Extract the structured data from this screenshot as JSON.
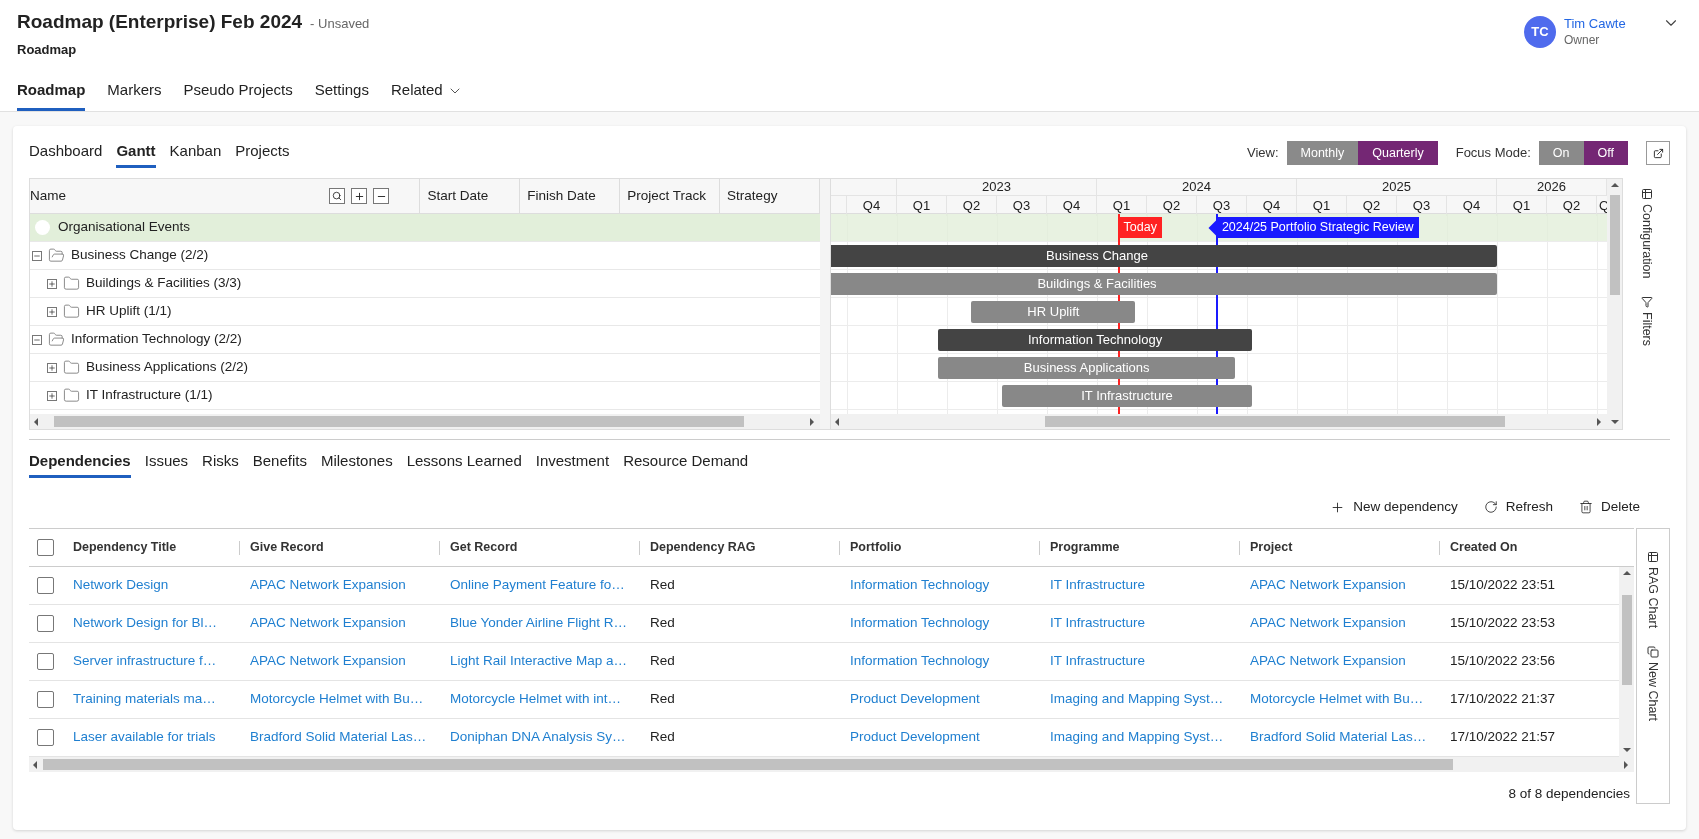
{
  "header": {
    "title": "Roadmap (Enterprise) Feb 2024",
    "status": "- Unsaved",
    "subtitle": "Roadmap"
  },
  "user": {
    "initials": "TC",
    "name": "Tim Cawte",
    "role": "Owner"
  },
  "nav_tabs": [
    {
      "label": "Roadmap",
      "selected": true,
      "dropdown": false
    },
    {
      "label": "Markers",
      "selected": false,
      "dropdown": false
    },
    {
      "label": "Pseudo Projects",
      "selected": false,
      "dropdown": false
    },
    {
      "label": "Settings",
      "selected": false,
      "dropdown": false
    },
    {
      "label": "Related",
      "selected": false,
      "dropdown": true
    }
  ],
  "view_tabs": [
    {
      "label": "Dashboard",
      "selected": false
    },
    {
      "label": "Gantt",
      "selected": true
    },
    {
      "label": "Kanban",
      "selected": false
    },
    {
      "label": "Projects",
      "selected": false
    }
  ],
  "view_switch": {
    "label": "View:",
    "options": [
      {
        "label": "Monthly",
        "selected": false
      },
      {
        "label": "Quarterly",
        "selected": true
      }
    ]
  },
  "focus_mode": {
    "label": "Focus Mode:",
    "options": [
      {
        "label": "On",
        "selected": false
      },
      {
        "label": "Off",
        "selected": true
      }
    ]
  },
  "gantt": {
    "columns": [
      "Name",
      "Start Date",
      "Finish Date",
      "Project Track",
      "Strategy"
    ],
    "years": [
      "2023",
      "2024",
      "2025",
      "2026"
    ],
    "quarters": [
      "Q4",
      "Q1",
      "Q2",
      "Q3",
      "Q4",
      "Q1",
      "Q2",
      "Q3",
      "Q4",
      "Q1",
      "Q2",
      "Q3",
      "Q4",
      "Q1",
      "Q2",
      "Q"
    ],
    "markers": [
      {
        "label": "Today",
        "kind": "today",
        "color": "#ff2222"
      },
      {
        "label": "2024/25 Portfolio Strategic Review",
        "kind": "milestone",
        "color": "#1a1aff"
      }
    ],
    "rows": [
      {
        "name": "Organisational Events",
        "kind": "events"
      },
      {
        "name": "Business Change (2/2)",
        "kind": "group",
        "expanded": true,
        "bar": {
          "label": "Business Change"
        },
        "children": [
          {
            "name": "Buildings & Facilities (3/3)",
            "kind": "group",
            "expanded": false,
            "bar": {
              "label": "Buildings & Facilities"
            }
          },
          {
            "name": "HR Uplift (1/1)",
            "kind": "group",
            "expanded": false,
            "bar": {
              "label": "HR Uplift"
            }
          }
        ]
      },
      {
        "name": "Information Technology (2/2)",
        "kind": "group",
        "expanded": true,
        "bar": {
          "label": "Information Technology"
        },
        "children": [
          {
            "name": "Business Applications (2/2)",
            "kind": "group",
            "expanded": false,
            "bar": {
              "label": "Business Applications"
            }
          },
          {
            "name": "IT Infrastructure (1/1)",
            "kind": "group",
            "expanded": false,
            "bar": {
              "label": "IT Infrastructure"
            }
          }
        ]
      }
    ]
  },
  "side_panel": [
    "Configuration",
    "Filters"
  ],
  "detail_tabs": [
    {
      "label": "Dependencies",
      "selected": true
    },
    {
      "label": "Issues",
      "selected": false
    },
    {
      "label": "Risks",
      "selected": false
    },
    {
      "label": "Benefits",
      "selected": false
    },
    {
      "label": "Milestones",
      "selected": false
    },
    {
      "label": "Lessons Learned",
      "selected": false
    },
    {
      "label": "Investment",
      "selected": false
    },
    {
      "label": "Resource Demand",
      "selected": false
    }
  ],
  "actions": [
    "New dependency",
    "Refresh",
    "Delete"
  ],
  "table": {
    "select_all": {
      "checked": false
    },
    "columns": [
      {
        "label": "Dependency Title",
        "kind": "link"
      },
      {
        "label": "Give Record",
        "kind": "link"
      },
      {
        "label": "Get Record",
        "kind": "link"
      },
      {
        "label": "Dependency RAG",
        "kind": "text"
      },
      {
        "label": "Portfolio",
        "kind": "link"
      },
      {
        "label": "Programme",
        "kind": "link"
      },
      {
        "label": "Project",
        "kind": "link"
      },
      {
        "label": "Created On",
        "kind": "text"
      }
    ],
    "rows": [
      {
        "selected": false,
        "cells": [
          "Network Design",
          "APAC Network Expansion",
          "Online Payment Feature fo…",
          "Red",
          "Information Technology",
          "IT Infrastructure",
          "APAC Network Expansion",
          "15/10/2022 23:51"
        ]
      },
      {
        "selected": false,
        "cells": [
          "Network Design for Bl…",
          "APAC Network Expansion",
          "Blue Yonder Airline Flight R…",
          "Red",
          "Information Technology",
          "IT Infrastructure",
          "APAC Network Expansion",
          "15/10/2022 23:53"
        ]
      },
      {
        "selected": false,
        "cells": [
          "Server infrastructure f…",
          "APAC Network Expansion",
          "Light Rail Interactive Map a…",
          "Red",
          "Information Technology",
          "IT Infrastructure",
          "APAC Network Expansion",
          "15/10/2022 23:56"
        ]
      },
      {
        "selected": false,
        "cells": [
          "Training materials ma…",
          "Motorcycle Helmet with Bu…",
          "Motorcycle Helmet with int…",
          "Red",
          "Product Development",
          "Imaging and Mapping Syst…",
          "Motorcycle Helmet with Bu…",
          "17/10/2022 21:37"
        ]
      },
      {
        "selected": false,
        "cells": [
          "Laser available for trials",
          "Bradford Solid Material Las…",
          "Doniphan DNA Analysis Sy…",
          "Red",
          "Product Development",
          "Imaging and Mapping Syst…",
          "Bradford Solid Material Las…",
          "17/10/2022 21:57"
        ]
      }
    ]
  },
  "footer": "8 of 8 dependencies",
  "chart_panel": [
    "RAG Chart",
    "New Chart"
  ]
}
